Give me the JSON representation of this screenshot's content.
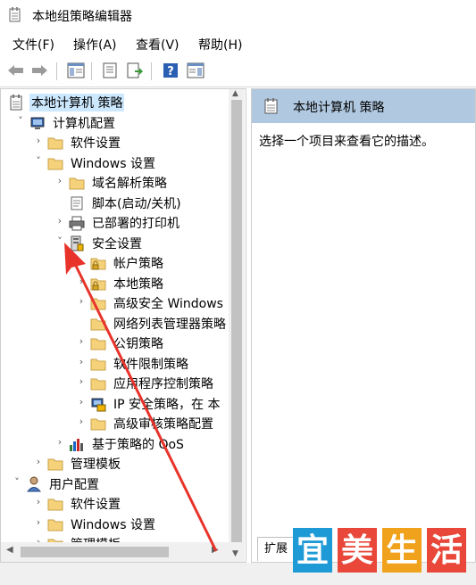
{
  "window": {
    "title": "本地组策略编辑器",
    "icon": "notepad-policy-icon"
  },
  "menu": [
    "文件(F)",
    "操作(A)",
    "查看(V)",
    "帮助(H)"
  ],
  "toolbar": {
    "buttons": [
      "back-arrow-icon",
      "forward-arrow-icon",
      "show-tree-icon",
      "properties-icon",
      "export-icon",
      "help-icon",
      "show-hide-action-pane-icon"
    ]
  },
  "tree": [
    {
      "label": "本地计算机 策略",
      "toggle": "",
      "icon": "policy-doc-icon",
      "selected": true
    },
    {
      "label": "计算机配置",
      "toggle": "˅",
      "icon": "computer-icon"
    },
    {
      "label": "软件设置",
      "toggle": "›",
      "icon": "folder-icon"
    },
    {
      "label": "Windows 设置",
      "toggle": "˅",
      "icon": "folder-icon"
    },
    {
      "label": "域名解析策略",
      "toggle": "›",
      "icon": "folder-icon"
    },
    {
      "label": "脚本(启动/关机)",
      "toggle": "",
      "icon": "script-icon"
    },
    {
      "label": "已部署的打印机",
      "toggle": "›",
      "icon": "printer-icon"
    },
    {
      "label": "安全设置",
      "toggle": "˅",
      "icon": "security-icon"
    },
    {
      "label": "帐户策略",
      "toggle": "›",
      "icon": "lock-folder-icon"
    },
    {
      "label": "本地策略",
      "toggle": "›",
      "icon": "lock-folder-icon"
    },
    {
      "label": "高级安全 Windows",
      "toggle": "›",
      "icon": "folder-icon"
    },
    {
      "label": "网络列表管理器策略",
      "toggle": "",
      "icon": "folder-icon"
    },
    {
      "label": "公钥策略",
      "toggle": "›",
      "icon": "folder-icon"
    },
    {
      "label": "软件限制策略",
      "toggle": "›",
      "icon": "folder-icon"
    },
    {
      "label": "应用程序控制策略",
      "toggle": "›",
      "icon": "folder-icon"
    },
    {
      "label": "IP 安全策略，在 本",
      "toggle": "›",
      "icon": "ip-security-icon"
    },
    {
      "label": "高级审核策略配置",
      "toggle": "›",
      "icon": "folder-icon"
    },
    {
      "label": "基于策略的 QoS",
      "toggle": "›",
      "icon": "chart-icon"
    },
    {
      "label": "管理模板",
      "toggle": "›",
      "icon": "folder-icon"
    },
    {
      "label": "用户配置",
      "toggle": "˅",
      "icon": "user-icon"
    },
    {
      "label": "软件设置",
      "toggle": "›",
      "icon": "folder-icon"
    },
    {
      "label": "Windows 设置",
      "toggle": "›",
      "icon": "folder-icon"
    },
    {
      "label": "管理模板",
      "toggle": "›",
      "icon": "folder-icon"
    }
  ],
  "right_pane": {
    "header": "本地计算机 策略",
    "description": "选择一个项目来查看它的描述。",
    "tab": "扩展"
  },
  "watermark": {
    "chars": [
      "宜",
      "美",
      "生",
      "活"
    ],
    "colors": [
      "#1e9ad6",
      "#e8473a",
      "#f1a21c",
      "#e8473a"
    ]
  },
  "colors": {
    "header_bg": "#b0c8e0",
    "selection": "#cce8ff",
    "arrow": "#e8332a"
  }
}
